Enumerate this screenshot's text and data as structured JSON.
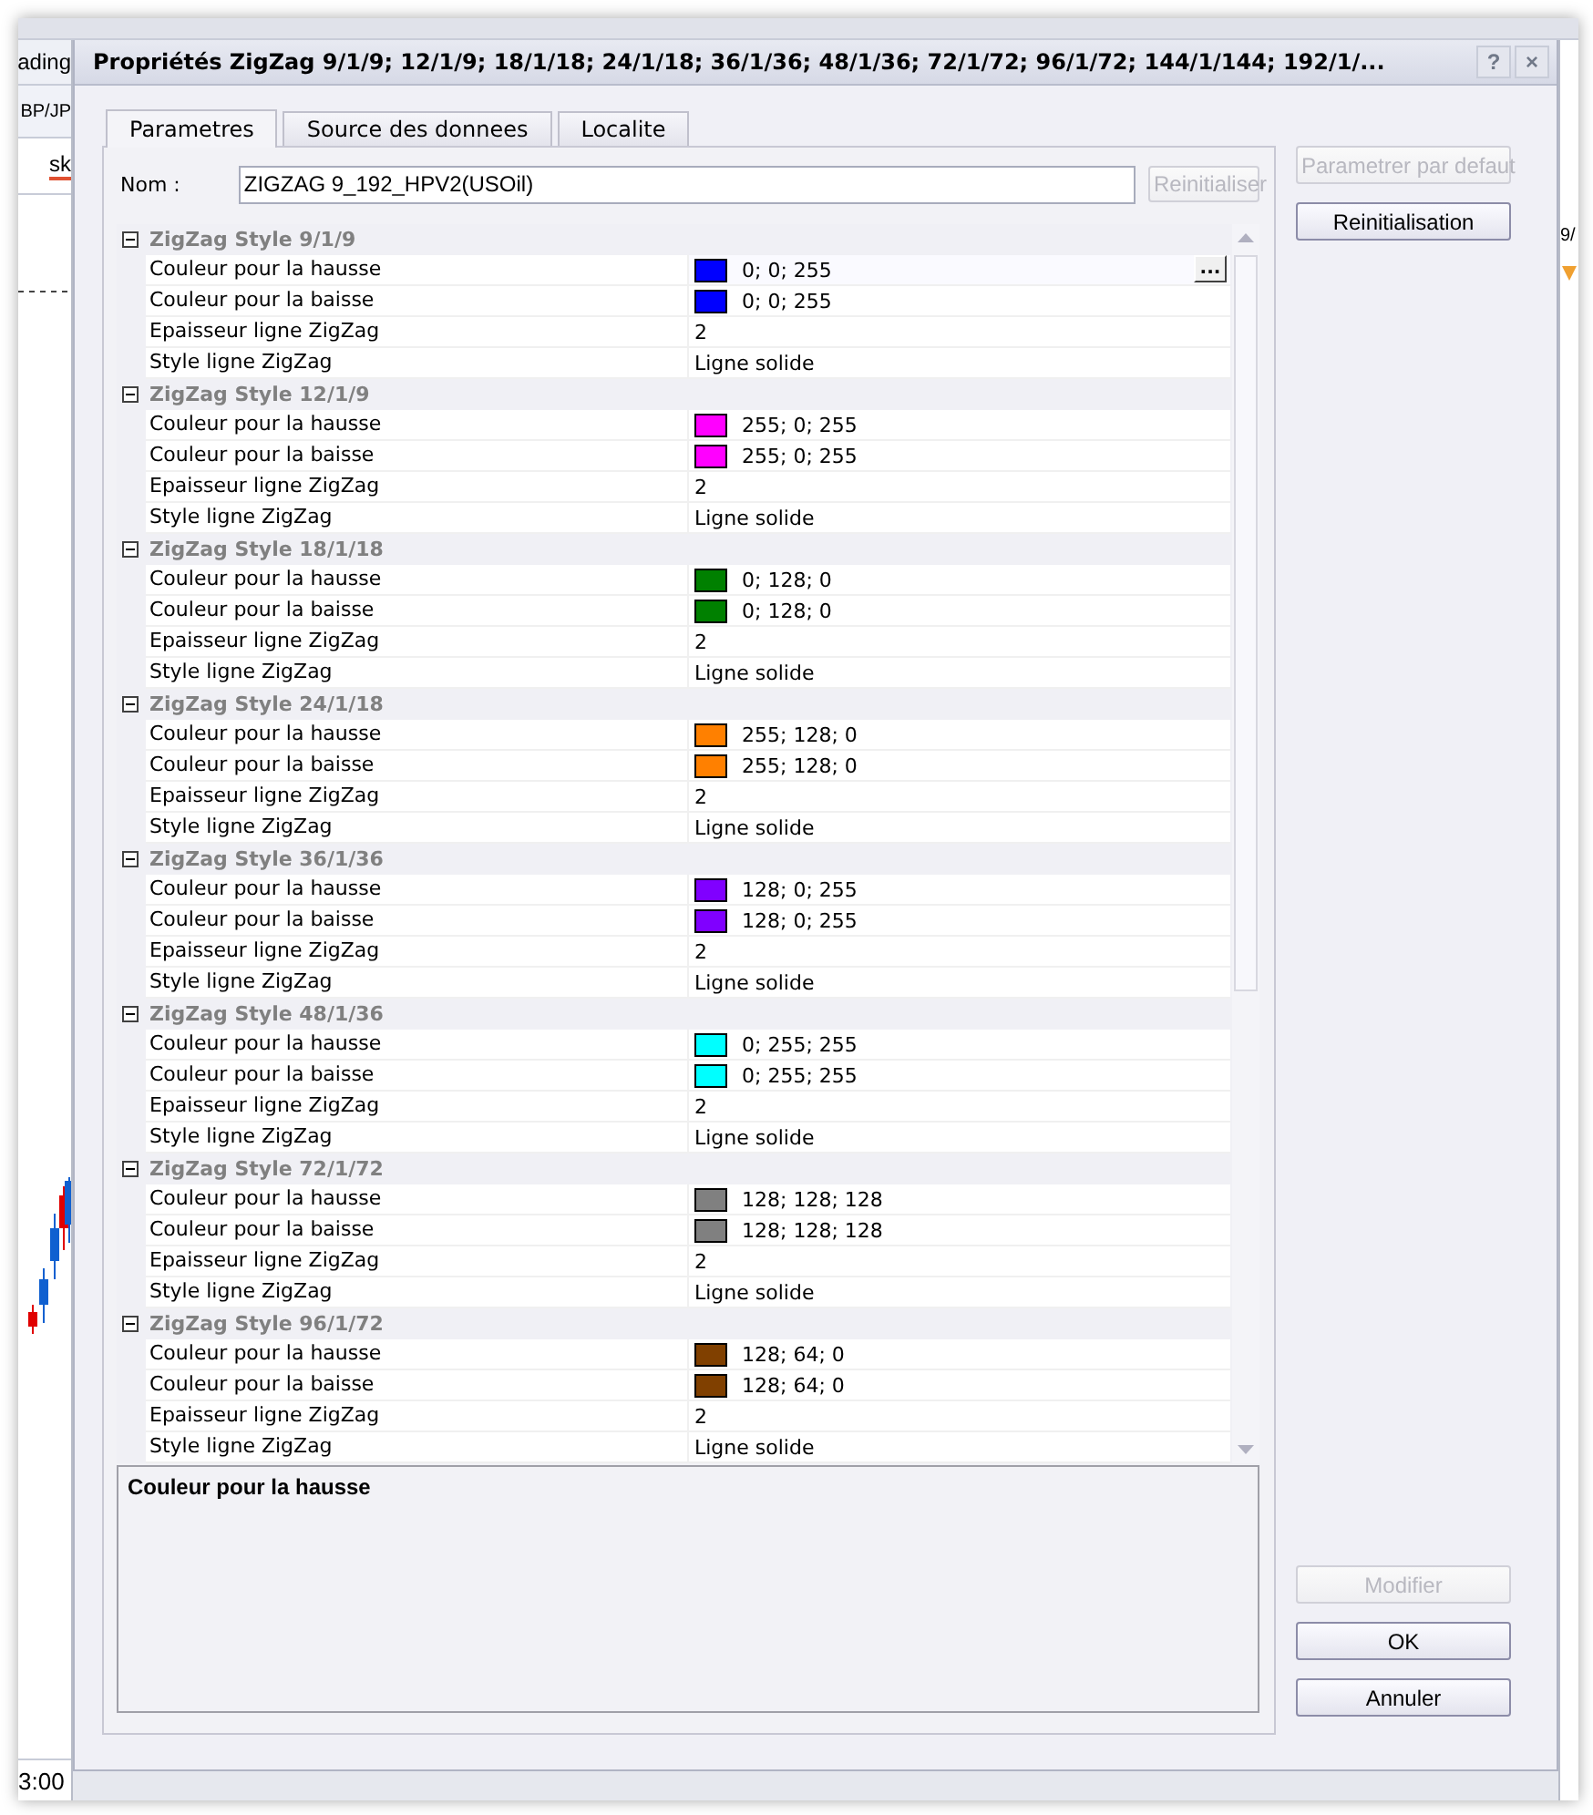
{
  "background_app": {
    "left_labels": [
      "ading",
      "BP/JP",
      "sk"
    ],
    "right_label": "9/",
    "time_label": "3:00"
  },
  "dialog": {
    "title": "Propriétés ZigZag 9/1/9; 12/1/9; 18/1/18; 24/1/18; 36/1/36; 48/1/36; 72/1/72; 96/1/72; 144/1/144; 192/1/...",
    "help_button": "?",
    "close_button": "×"
  },
  "tabs": [
    {
      "label": "Parametres",
      "selected": true
    },
    {
      "label": "Source des donnees",
      "selected": false
    },
    {
      "label": "Localite",
      "selected": false
    }
  ],
  "name_field": {
    "label": "Nom :",
    "value": "ZIGZAG 9_192_HPV2(USOil)",
    "reset_button": {
      "label": "Reinitialiser",
      "disabled": true
    }
  },
  "groups": [
    {
      "title": "ZigZag Style 9/1/9",
      "expanded": true,
      "properties": [
        {
          "label": "Couleur pour la hausse",
          "kind": "color",
          "value": "0; 0; 255",
          "color": "#0000ff",
          "selected": true
        },
        {
          "label": "Couleur pour la baisse",
          "kind": "color",
          "value": "0; 0; 255",
          "color": "#0000ff",
          "selected": false
        },
        {
          "label": "Epaisseur ligne ZigZag",
          "kind": "text",
          "value": "2",
          "selected": false
        },
        {
          "label": "Style ligne ZigZag",
          "kind": "text",
          "value": "Ligne solide",
          "selected": false
        }
      ]
    },
    {
      "title": "ZigZag Style 12/1/9",
      "expanded": true,
      "properties": [
        {
          "label": "Couleur pour la hausse",
          "kind": "color",
          "value": "255; 0; 255",
          "color": "#ff00ff",
          "selected": false
        },
        {
          "label": "Couleur pour la baisse",
          "kind": "color",
          "value": "255; 0; 255",
          "color": "#ff00ff",
          "selected": false
        },
        {
          "label": "Epaisseur ligne ZigZag",
          "kind": "text",
          "value": "2",
          "selected": false
        },
        {
          "label": "Style ligne ZigZag",
          "kind": "text",
          "value": "Ligne solide",
          "selected": false
        }
      ]
    },
    {
      "title": "ZigZag Style 18/1/18",
      "expanded": true,
      "properties": [
        {
          "label": "Couleur pour la hausse",
          "kind": "color",
          "value": "0; 128; 0",
          "color": "#008000",
          "selected": false
        },
        {
          "label": "Couleur pour la baisse",
          "kind": "color",
          "value": "0; 128; 0",
          "color": "#008000",
          "selected": false
        },
        {
          "label": "Epaisseur ligne ZigZag",
          "kind": "text",
          "value": "2",
          "selected": false
        },
        {
          "label": "Style ligne ZigZag",
          "kind": "text",
          "value": "Ligne solide",
          "selected": false
        }
      ]
    },
    {
      "title": "ZigZag Style 24/1/18",
      "expanded": true,
      "properties": [
        {
          "label": "Couleur pour la hausse",
          "kind": "color",
          "value": "255; 128; 0",
          "color": "#ff8000",
          "selected": false
        },
        {
          "label": "Couleur pour la baisse",
          "kind": "color",
          "value": "255; 128; 0",
          "color": "#ff8000",
          "selected": false
        },
        {
          "label": "Epaisseur ligne ZigZag",
          "kind": "text",
          "value": "2",
          "selected": false
        },
        {
          "label": "Style ligne ZigZag",
          "kind": "text",
          "value": "Ligne solide",
          "selected": false
        }
      ]
    },
    {
      "title": "ZigZag Style 36/1/36",
      "expanded": true,
      "properties": [
        {
          "label": "Couleur pour la hausse",
          "kind": "color",
          "value": "128; 0; 255",
          "color": "#8000ff",
          "selected": false
        },
        {
          "label": "Couleur pour la baisse",
          "kind": "color",
          "value": "128; 0; 255",
          "color": "#8000ff",
          "selected": false
        },
        {
          "label": "Epaisseur ligne ZigZag",
          "kind": "text",
          "value": "2",
          "selected": false
        },
        {
          "label": "Style ligne ZigZag",
          "kind": "text",
          "value": "Ligne solide",
          "selected": false
        }
      ]
    },
    {
      "title": "ZigZag Style 48/1/36",
      "expanded": true,
      "properties": [
        {
          "label": "Couleur pour la hausse",
          "kind": "color",
          "value": "0; 255; 255",
          "color": "#00ffff",
          "selected": false
        },
        {
          "label": "Couleur pour la baisse",
          "kind": "color",
          "value": "0; 255; 255",
          "color": "#00ffff",
          "selected": false
        },
        {
          "label": "Epaisseur ligne ZigZag",
          "kind": "text",
          "value": "2",
          "selected": false
        },
        {
          "label": "Style ligne ZigZag",
          "kind": "text",
          "value": "Ligne solide",
          "selected": false
        }
      ]
    },
    {
      "title": "ZigZag Style 72/1/72",
      "expanded": true,
      "properties": [
        {
          "label": "Couleur pour la hausse",
          "kind": "color",
          "value": "128; 128; 128",
          "color": "#808080",
          "selected": false
        },
        {
          "label": "Couleur pour la baisse",
          "kind": "color",
          "value": "128; 128; 128",
          "color": "#808080",
          "selected": false
        },
        {
          "label": "Epaisseur ligne ZigZag",
          "kind": "text",
          "value": "2",
          "selected": false
        },
        {
          "label": "Style ligne ZigZag",
          "kind": "text",
          "value": "Ligne solide",
          "selected": false
        }
      ]
    },
    {
      "title": "ZigZag Style 96/1/72",
      "expanded": true,
      "properties": [
        {
          "label": "Couleur pour la hausse",
          "kind": "color",
          "value": "128; 64; 0",
          "color": "#804000",
          "selected": false
        },
        {
          "label": "Couleur pour la baisse",
          "kind": "color",
          "value": "128; 64; 0",
          "color": "#804000",
          "selected": false
        },
        {
          "label": "Epaisseur ligne ZigZag",
          "kind": "text",
          "value": "2",
          "selected": false
        },
        {
          "label": "Style ligne ZigZag",
          "kind": "text",
          "value": "Ligne solide",
          "selected": false
        }
      ]
    }
  ],
  "edit_button_label": "...",
  "description": "Couleur pour la hausse",
  "side_buttons_top": [
    {
      "label": "Parametrer par defaut",
      "disabled": true
    },
    {
      "label": "Reinitialisation",
      "disabled": false
    }
  ],
  "side_buttons_bottom": [
    {
      "label": "Modifier",
      "disabled": true
    },
    {
      "label": "OK",
      "disabled": false
    },
    {
      "label": "Annuler",
      "disabled": false
    }
  ]
}
